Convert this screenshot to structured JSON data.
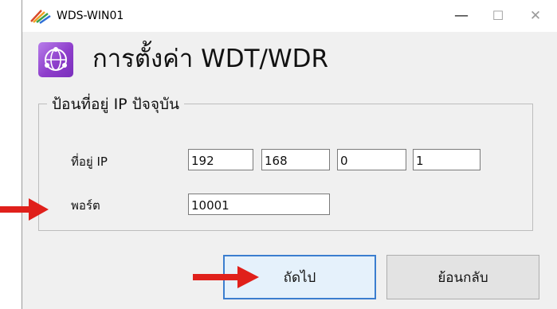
{
  "window": {
    "title": "WDS-WIN01",
    "minimize_symbol": "—",
    "maximize_symbol": "☐",
    "close_symbol": "✕"
  },
  "header": {
    "title": "การตั้งค่า WDT/WDR",
    "icon": "network-globe-icon"
  },
  "group": {
    "legend": "ป้อนที่อยู่ IP ปัจจุบัน",
    "ip_label": "ที่อยู่ IP",
    "ip_octets": [
      "192",
      "168",
      "0",
      "1"
    ],
    "port_label": "พอร์ต",
    "port_value": "10001"
  },
  "buttons": {
    "next": "ถัดไป",
    "back": "ย้อนกลับ"
  },
  "annotations": {
    "arrow_color": "#e0201b"
  },
  "colors": {
    "icon_purple": "#8e3ecb",
    "focus_border": "#3b7ecf"
  }
}
